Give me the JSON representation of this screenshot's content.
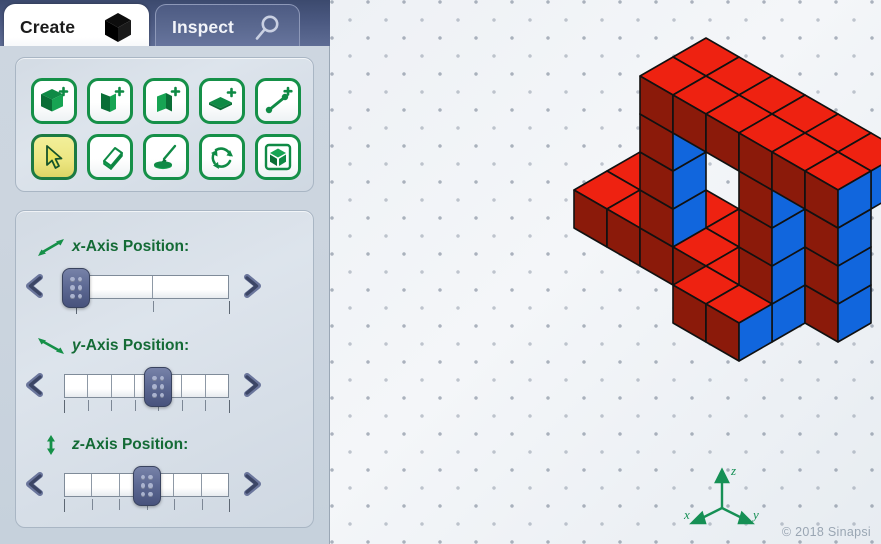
{
  "app": {
    "copyright": "© 2018 Sinapsi"
  },
  "tabs": [
    {
      "id": "create",
      "label": "Create",
      "icon": "cube-icon",
      "active": true
    },
    {
      "id": "inspect",
      "label": "Inspect",
      "icon": "magnifier-icon",
      "active": false
    }
  ],
  "toolbox": {
    "rows": [
      [
        {
          "name": "add-cube-tool",
          "icon": "cube-plus-icon",
          "active": false
        },
        {
          "name": "add-wall-left-tool",
          "icon": "wall-left-plus-icon",
          "active": false
        },
        {
          "name": "add-wall-right-tool",
          "icon": "wall-right-plus-icon",
          "active": false
        },
        {
          "name": "add-floor-tool",
          "icon": "floor-plus-icon",
          "active": false
        },
        {
          "name": "add-line-tool",
          "icon": "line-plus-icon",
          "active": false
        }
      ],
      [
        {
          "name": "select-tool",
          "icon": "cursor-arrow-icon",
          "active": true
        },
        {
          "name": "erase-tool",
          "icon": "eraser-icon",
          "active": false
        },
        {
          "name": "paint-tool",
          "icon": "paintbrush-icon",
          "active": false
        },
        {
          "name": "rotate-tool",
          "icon": "rotate-icon",
          "active": false
        },
        {
          "name": "view-tool",
          "icon": "cube-split-icon",
          "active": false
        }
      ]
    ]
  },
  "axis_controls": [
    {
      "id": "x",
      "label_axis": "x",
      "label_rest": "-Axis Position:",
      "gizmo": "diagonal-arrow-up-right-icon",
      "segments": 2,
      "ticks": 3,
      "value": 0,
      "max": 2,
      "prev_label": "‹",
      "next_label": "›"
    },
    {
      "id": "y",
      "label_axis": "y",
      "label_rest": "-Axis Position:",
      "gizmo": "diagonal-arrow-down-right-icon",
      "segments": 7,
      "ticks": 8,
      "value": 4,
      "max": 7,
      "prev_label": "‹",
      "next_label": "›"
    },
    {
      "id": "z",
      "label_axis": "z",
      "label_rest": "-Axis Position:",
      "gizmo": "vertical-arrow-icon",
      "segments": 6,
      "ticks": 7,
      "value": 3,
      "max": 6,
      "prev_label": "‹",
      "next_label": "›"
    }
  ],
  "canvas": {
    "axis_gizmo": {
      "x_label": "x",
      "y_label": "y",
      "z_label": "z"
    },
    "colors": {
      "cube_top": "#ee2211",
      "cube_left": "#8b1a0a",
      "cube_right": "#1166dd",
      "cube_outline": "#111111"
    },
    "model": {
      "description": "isometric voxel staircase loop with rectangular hole",
      "cube_count": 34
    }
  }
}
